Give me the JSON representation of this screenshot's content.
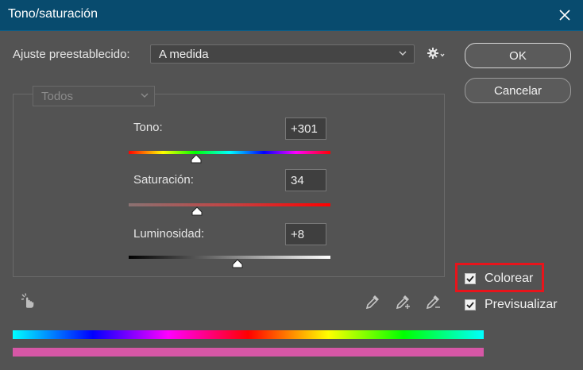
{
  "window": {
    "title": "Tono/saturación"
  },
  "preset": {
    "label": "Ajuste preestablecido:",
    "value": "A medida"
  },
  "buttons": {
    "ok": "OK",
    "cancel": "Cancelar"
  },
  "channel": {
    "value": "Todos"
  },
  "sliders": {
    "hue": {
      "label": "Tono:",
      "value": "+301",
      "min": -180,
      "max": 180,
      "level": 301
    },
    "saturation": {
      "label": "Saturación:",
      "value": "34",
      "min": 0,
      "max": 100,
      "level": 34
    },
    "lightness": {
      "label": "Luminosidad:",
      "value": "+8",
      "min": -100,
      "max": 100,
      "level": 8
    }
  },
  "options": {
    "colorize": {
      "label": "Colorear",
      "checked": true
    },
    "preview": {
      "label": "Previsualizar",
      "checked": true
    }
  },
  "colors": {
    "titlebar": "#084b6e",
    "background": "#535353",
    "highlight": "#e8141b",
    "result_bar": "#d657a6"
  },
  "icons": {
    "close": "close-icon",
    "settings": "gear-icon",
    "target_adjust": "hand-target-icon",
    "eyedropper": "eyedropper-icon",
    "eyedropper_add": "eyedropper-plus-icon",
    "eyedropper_subtract": "eyedropper-minus-icon"
  }
}
